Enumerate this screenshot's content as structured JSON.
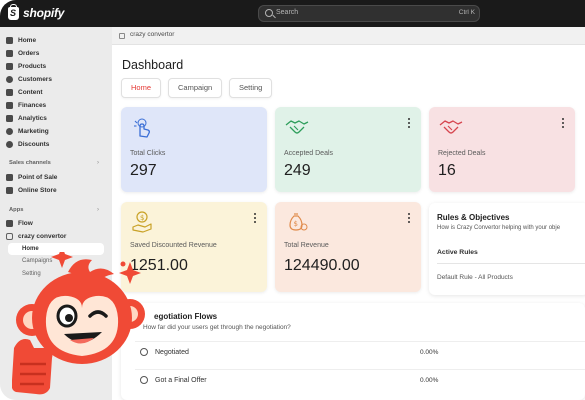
{
  "topbar": {
    "brand": "shopify",
    "search_placeholder": "Search",
    "search_shortcut": "Ctrl K"
  },
  "sidebar": {
    "items": [
      {
        "label": "Home",
        "icon": "home-icon"
      },
      {
        "label": "Orders",
        "icon": "inbox-icon"
      },
      {
        "label": "Products",
        "icon": "tag-icon"
      },
      {
        "label": "Customers",
        "icon": "person-icon"
      },
      {
        "label": "Content",
        "icon": "file-icon"
      },
      {
        "label": "Finances",
        "icon": "bank-icon"
      },
      {
        "label": "Analytics",
        "icon": "chart-icon"
      },
      {
        "label": "Marketing",
        "icon": "target-icon"
      },
      {
        "label": "Discounts",
        "icon": "discount-icon"
      }
    ],
    "sales_channels_title": "Sales channels",
    "sales_channels": [
      {
        "label": "Point of Sale",
        "icon": "pos-icon"
      },
      {
        "label": "Online Store",
        "icon": "store-icon"
      }
    ],
    "apps_title": "Apps",
    "apps": [
      {
        "label": "Flow",
        "icon": "flow-icon"
      },
      {
        "label": "crazy convertor",
        "icon": "app-icon"
      }
    ],
    "app_sub_items": [
      "Home",
      "Campaigns",
      "Setting"
    ]
  },
  "main": {
    "breadcrumb": "crazy convertor",
    "title": "Dashboard",
    "tabs": [
      {
        "label": "Home",
        "active": true
      },
      {
        "label": "Campaign",
        "active": false
      },
      {
        "label": "Setting",
        "active": false
      }
    ],
    "cards": [
      {
        "label": "Total Clicks",
        "value": "297",
        "bg": "#dfe6f9",
        "icon": "click-hand-icon",
        "icon_color": "#3b6fd6"
      },
      {
        "label": "Accepted Deals",
        "value": "249",
        "bg": "#e0f2e8",
        "icon": "handshake-icon",
        "icon_color": "#2e9e5b"
      },
      {
        "label": "Rejected Deals",
        "value": "16",
        "bg": "#f8e1e3",
        "icon": "handshake-icon",
        "icon_color": "#d6454f"
      },
      {
        "label": "Saved Discounted Revenue",
        "value": "1251.00",
        "bg": "#fbf3d9",
        "icon": "money-hand-icon",
        "icon_color": "#c9a227"
      },
      {
        "label": "Total Revenue",
        "value": "124490.00",
        "bg": "#fbe8de",
        "icon": "money-bag-icon",
        "icon_color": "#e08a4a"
      }
    ],
    "rules": {
      "title": "Rules & Objectives",
      "subtitle": "How is Crazy Convertor helping with your obje",
      "active_label": "Active Rules",
      "default_rule": "Default Rule - All Products"
    },
    "negotiation": {
      "title": "egotiation Flows",
      "subtitle": "How far did your users get through the negotiation?",
      "rows": [
        {
          "label": "Negotiated",
          "value": "0.00%",
          "icon": "chat-icon"
        },
        {
          "label": "Got a Final Offer",
          "value": "0.00%",
          "icon": "phone-icon"
        }
      ]
    }
  },
  "colors": {
    "accent_red": "#e53935",
    "mascot_red": "#f04a36"
  }
}
